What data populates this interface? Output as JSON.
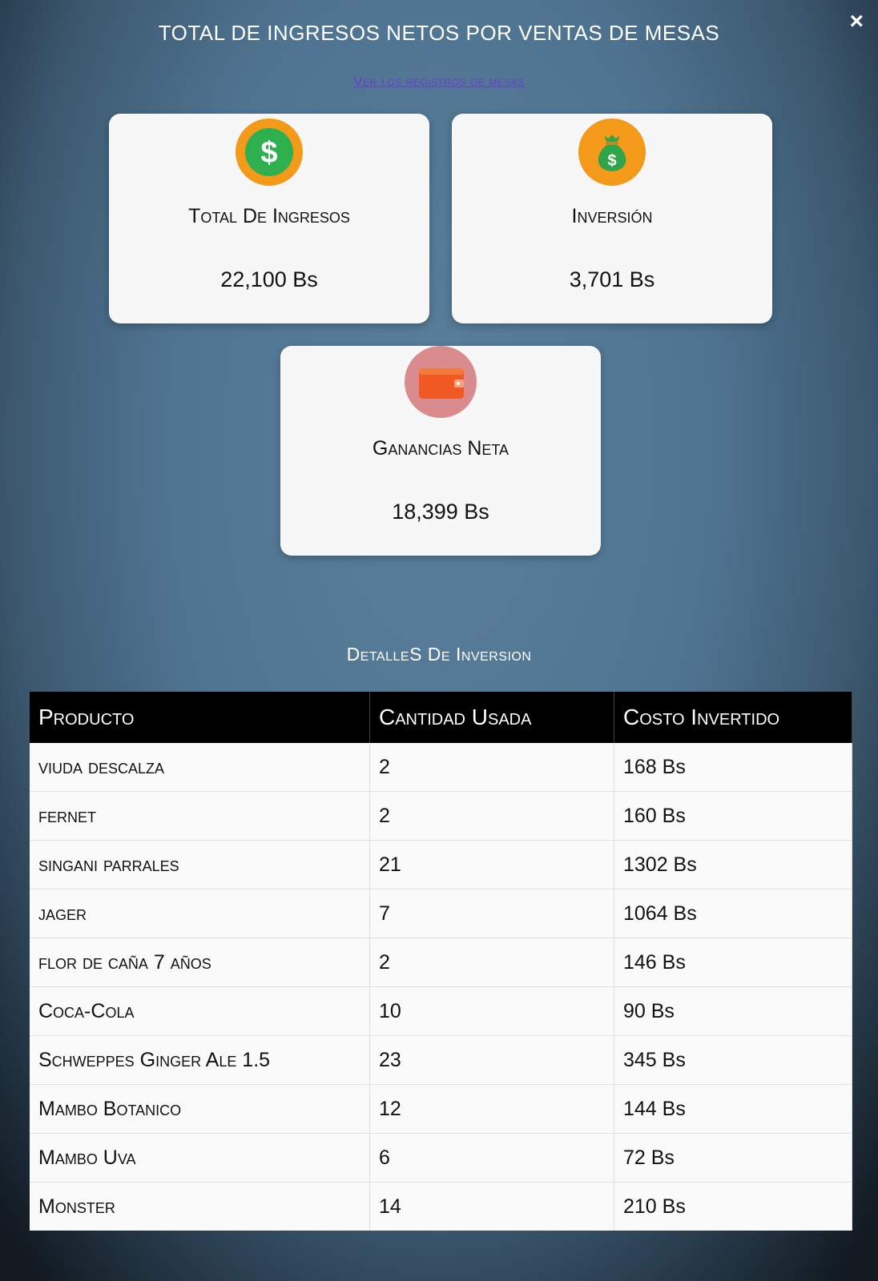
{
  "header": {
    "title": "TOTAL DE INGRESOS NETOS POR VENTAS DE MESAS",
    "records_link": "Ver los registros de mesas",
    "close_label": "×"
  },
  "summary_cards": [
    {
      "label": "Total De Ingresos",
      "value": "22,100 Bs",
      "icon": "dollar-coin-icon",
      "icon_bg": "#f39a1a",
      "icon_fg": "#2fb04f"
    },
    {
      "label": "Inversión",
      "value": "3,701 Bs",
      "icon": "money-bag-icon",
      "icon_bg": "#f39a1a",
      "icon_fg": "#2fa44a"
    },
    {
      "label": "Ganancias Neta",
      "value": "18,399 Bs",
      "icon": "wallet-icon",
      "icon_bg": "#d98b8e",
      "icon_fg": "#f05a22"
    }
  ],
  "investment": {
    "title": "DetalleS De Inversion",
    "columns": [
      "Producto",
      "Cantidad Usada",
      "Costo Invertido"
    ],
    "rows": [
      [
        "viuda descalza",
        "2",
        "168 Bs"
      ],
      [
        "fernet",
        "2",
        "160 Bs"
      ],
      [
        "singani parrales",
        "21",
        "1302 Bs"
      ],
      [
        "jager",
        "7",
        "1064 Bs"
      ],
      [
        "flor de caña 7 años",
        "2",
        "146 Bs"
      ],
      [
        "Coca-Cola",
        "10",
        "90 Bs"
      ],
      [
        "Schweppes Ginger Ale 1.5",
        "23",
        "345 Bs"
      ],
      [
        "Mambo Botanico",
        "12",
        "144 Bs"
      ],
      [
        "Mambo Uva",
        "6",
        "72 Bs"
      ],
      [
        "Monster",
        "14",
        "210 Bs"
      ]
    ]
  },
  "colors": {
    "link": "#6a3fd1",
    "table_header_bg": "#000000",
    "card_bg": "#f7f7f7"
  }
}
